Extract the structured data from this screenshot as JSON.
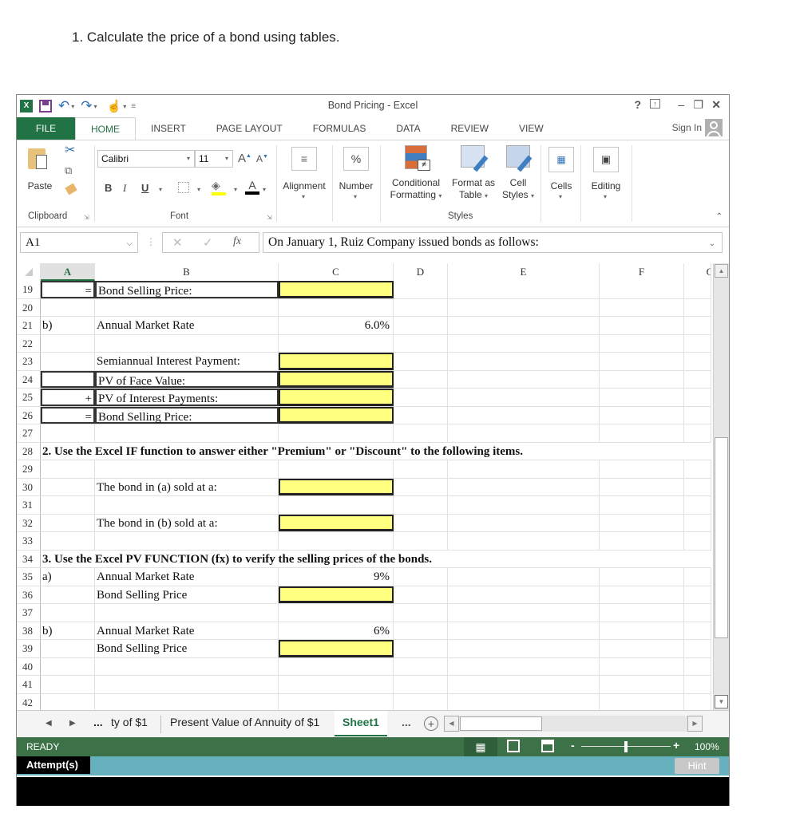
{
  "question": "1.  Calculate the price of a bond using tables.",
  "window": {
    "title": "Bond Pricing - Excel",
    "help": "?",
    "sign_in": "Sign In"
  },
  "tabs": [
    "FILE",
    "HOME",
    "INSERT",
    "PAGE LAYOUT",
    "FORMULAS",
    "DATA",
    "REVIEW",
    "VIEW"
  ],
  "ribbon": {
    "paste": "Paste",
    "clipboard": "Clipboard",
    "font_name": "Calibri",
    "font_size": "11",
    "bold": "B",
    "italic": "I",
    "underline": "U",
    "font": "Font",
    "alignment": "Alignment",
    "number": "Number",
    "percent": "%",
    "conditional_formatting_1": "Conditional",
    "conditional_formatting_2": "Formatting",
    "format_as_table_1": "Format as",
    "format_as_table_2": "Table",
    "cell_styles_1": "Cell",
    "cell_styles_2": "Styles",
    "styles": "Styles",
    "cells": "Cells",
    "editing": "Editing"
  },
  "formula_bar": {
    "name_box": "A1",
    "fx": "fx",
    "content": "On January 1,  Ruiz Company issued bonds as follows:"
  },
  "columns": [
    "A",
    "B",
    "C",
    "D",
    "E",
    "F",
    "G"
  ],
  "rows": [
    {
      "n": "19",
      "a": "=",
      "b": "Bond Selling Price:",
      "c": "",
      "c_input": true,
      "box_ab": true
    },
    {
      "n": "20"
    },
    {
      "n": "21",
      "a": "b)",
      "b": "Annual Market Rate",
      "c": "6.0%"
    },
    {
      "n": "22"
    },
    {
      "n": "23",
      "b": "Semiannual Interest Payment:",
      "c": "",
      "c_input": true
    },
    {
      "n": "24",
      "b": "PV of Face Value:",
      "c": "",
      "c_input": true,
      "box_ab": true
    },
    {
      "n": "25",
      "a": "+",
      "b": "PV of Interest Payments:",
      "c": "",
      "c_input": true,
      "box_ab": true
    },
    {
      "n": "26",
      "a": "=",
      "b": "Bond Selling Price:",
      "c": "",
      "c_input": true,
      "box_ab": true
    },
    {
      "n": "27"
    },
    {
      "n": "28",
      "heading": "2. Use the Excel IF function to answer either \"Premium\" or \"Discount\" to the following items."
    },
    {
      "n": "29"
    },
    {
      "n": "30",
      "b": "The bond in (a) sold at a:",
      "c": "",
      "c_input": true
    },
    {
      "n": "31"
    },
    {
      "n": "32",
      "b": "The bond in (b) sold at a:",
      "c": "",
      "c_input": true
    },
    {
      "n": "33"
    },
    {
      "n": "34",
      "heading": "3.  Use the Excel PV FUNCTION (fx) to verify the selling prices of the bonds."
    },
    {
      "n": "35",
      "a": "a)",
      "b": "Annual Market Rate",
      "c": "9%"
    },
    {
      "n": "36",
      "b": "Bond Selling Price",
      "c": "",
      "c_input": true
    },
    {
      "n": "37"
    },
    {
      "n": "38",
      "a": "b)",
      "b": "Annual Market Rate",
      "c": "6%"
    },
    {
      "n": "39",
      "b": "Bond Selling Price",
      "c": "",
      "c_input": true
    },
    {
      "n": "40"
    },
    {
      "n": "41"
    },
    {
      "n": "42"
    }
  ],
  "sheet_tabs": {
    "ellipsis_left": "...",
    "tab1": "ty of $1",
    "tab2": "Present Value of Annuity of $1",
    "active": "Sheet1",
    "ellipsis_right": "..."
  },
  "status": {
    "ready": "READY",
    "zoom": "100%",
    "zoom_minus": "-",
    "zoom_plus": "+"
  },
  "bottom": {
    "attempts": "Attempt(s)",
    "hint": "Hint"
  },
  "colors": {
    "excel_green": "#217346",
    "status_green": "#3d7249",
    "input_yellow": "#ffff80",
    "attempt_bar": "#67b1be"
  }
}
